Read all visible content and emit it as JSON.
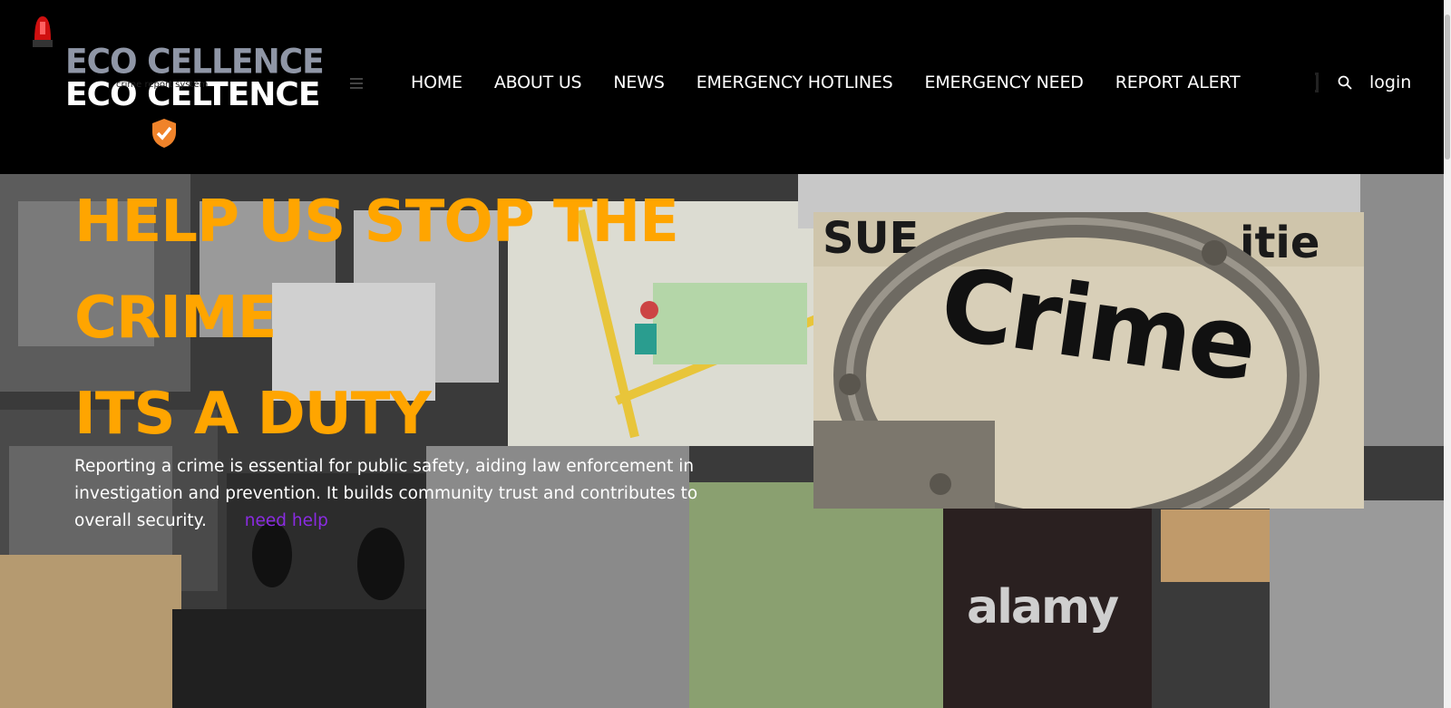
{
  "brand": {
    "name_top": "ECO CELLENCE",
    "name_bottom": "ECO CELTENCE",
    "tagline": "crime report system"
  },
  "nav": {
    "items": [
      {
        "label": "HOME"
      },
      {
        "label": "ABOUT US"
      },
      {
        "label": "NEWS"
      },
      {
        "label": "EMERGENCY HOTLINES"
      },
      {
        "label": "EMERGENCY NEED"
      },
      {
        "label": "REPORT ALERT"
      }
    ],
    "login_label": "login"
  },
  "hero": {
    "title_lines": [
      "HELP US STOP THE",
      "CRIME",
      "ITS A DUTY"
    ],
    "body": "Reporting a crime is essential for public safety, aiding law enforcement in investigation and prevention. It builds community trust and contributes to overall security.",
    "link_label": "need help"
  },
  "image": {
    "newsprint_word": "Crime",
    "background_watermark": "alamy"
  },
  "colors": {
    "accent": "#ffa500",
    "link": "#8a2be2",
    "header_bg": "#000000"
  },
  "icons": [
    "siren-icon",
    "shield-check-icon",
    "hamburger-icon",
    "search-icon"
  ]
}
